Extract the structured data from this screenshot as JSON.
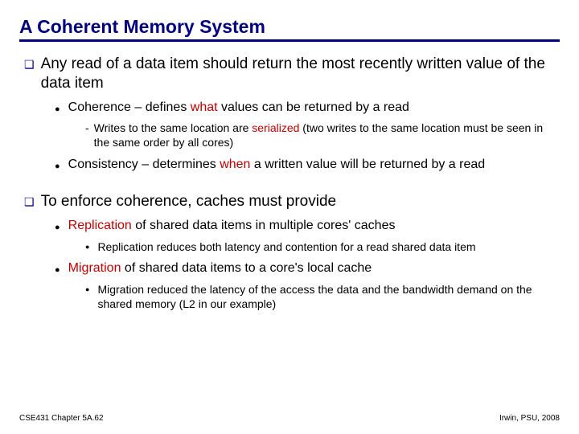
{
  "title": "A Coherent Memory System",
  "p1": {
    "text": "Any read of a data item should return the most recently written value of the data item",
    "coh_pre": "Coherence – defines ",
    "coh_em": "what",
    "coh_post": " values can be returned by a read",
    "ser_pre": "Writes to the same location are ",
    "ser_em": "serialized",
    "ser_post": " (two writes to the same location must be seen in the same order by all cores)",
    "con_pre": "Consistency – determines ",
    "con_em": "when",
    "con_post": " a written value will be returned by a read"
  },
  "p2": {
    "text": "To enforce coherence, caches must provide",
    "rep_em": "Replication",
    "rep_post": " of shared data items in multiple cores' caches",
    "rep_sub": "Replication reduces both latency and contention for a read shared data item",
    "mig_em": "Migration",
    "mig_post": " of shared data items to a core's local cache",
    "mig_sub": "Migration reduced the latency of the access the data and the bandwidth demand on the shared memory (L2 in our example)"
  },
  "footer": {
    "left": "CSE431  Chapter 5A.62",
    "right": "Irwin, PSU, 2008"
  }
}
